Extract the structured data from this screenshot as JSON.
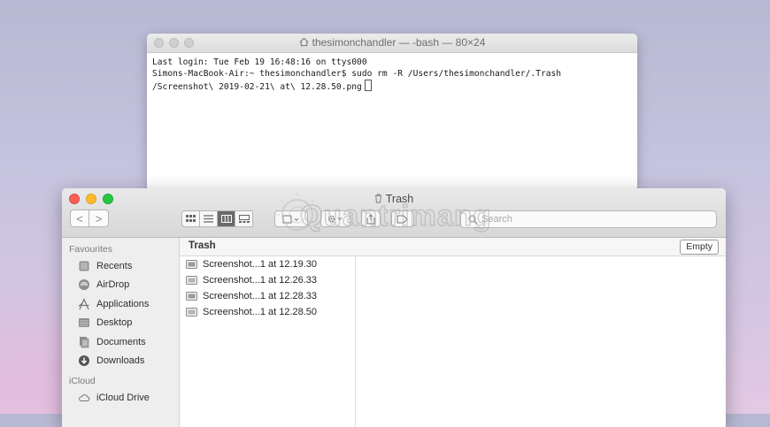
{
  "terminal": {
    "title": "thesimonchandler — -bash — 80×24",
    "lines": [
      "Last login: Tue Feb 19 16:48:16 on ttys000",
      "Simons-MacBook-Air:~ thesimonchandler$ sudo rm -R /Users/thesimonchandler/.Trash",
      "/Screenshot\\ 2019-02-21\\ at\\ 12.28.50.png"
    ]
  },
  "finder": {
    "title": "Trash",
    "nav": {
      "back": "<",
      "forward": ">"
    },
    "search_placeholder": "Search",
    "sidebar": {
      "favourites_heading": "Favourites",
      "items": [
        {
          "label": "Recents",
          "icon": "clock-icon"
        },
        {
          "label": "AirDrop",
          "icon": "airdrop-icon"
        },
        {
          "label": "Applications",
          "icon": "applications-icon"
        },
        {
          "label": "Desktop",
          "icon": "desktop-icon"
        },
        {
          "label": "Documents",
          "icon": "documents-icon"
        },
        {
          "label": "Downloads",
          "icon": "downloads-icon"
        }
      ],
      "icloud_heading": "iCloud",
      "icloud_items": [
        {
          "label": "iCloud Drive",
          "icon": "cloud-icon"
        }
      ]
    },
    "path_title": "Trash",
    "empty_label": "Empty",
    "files": [
      "Screenshot...1 at 12.19.30",
      "Screenshot...1 at 12.26.33",
      "Screenshot...1 at 12.28.33",
      "Screenshot...1 at 12.28.50"
    ],
    "watermark": "Quantrimang"
  }
}
